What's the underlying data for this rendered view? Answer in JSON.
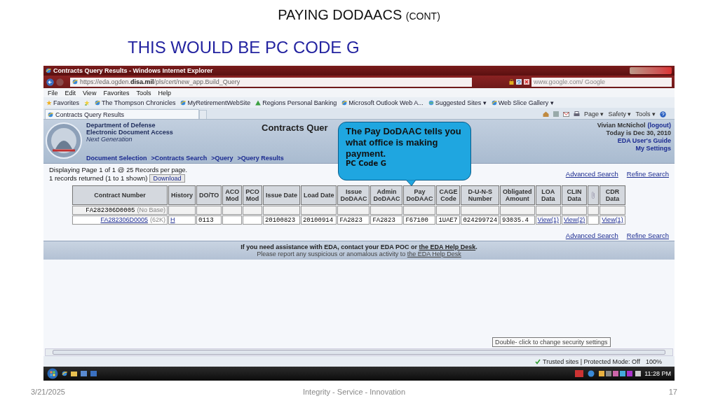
{
  "slide": {
    "title": "PAYING DODAACS",
    "title_suffix": "(CONT)",
    "subtitle": "THIS WOULD BE PC CODE G"
  },
  "browser": {
    "window_title": "Contracts Query Results - Windows Internet Explorer",
    "address": "https://eda.ogden.**disa.mil**/pls/cert/new_app.Build_Query",
    "search_placeholder": "www.google.com/ Google",
    "menu": [
      "File",
      "Edit",
      "View",
      "Favorites",
      "Tools",
      "Help"
    ],
    "favorites_label": "Favorites",
    "favorites": [
      {
        "label": "The Thompson Chronicles",
        "kind": "page"
      },
      {
        "label": "MyRetirementWebSite",
        "kind": "page"
      },
      {
        "label": "Regions  Personal Banking",
        "kind": "warning"
      },
      {
        "label": "Microsoft Outlook Web A...",
        "kind": "page"
      },
      {
        "label": "Suggested Sites ▾",
        "kind": "gallery"
      },
      {
        "label": "Web Slice Gallery ▾",
        "kind": "page"
      }
    ],
    "tab": {
      "label": "Contracts Query Results",
      "selected": true
    },
    "commands": [
      "Page ▾",
      "Safety ▾",
      "Tools ▾"
    ],
    "status": {
      "zone": "Trusted sites | Protected Mode: Off",
      "tooltip": "Double- click to change security settings",
      "zoom": "100%"
    },
    "clock": "11:28 PM"
  },
  "site": {
    "org": [
      "Department of Defense",
      "Electronic Document Access"
    ],
    "org_tagline": "Next Generation",
    "page_title": "Contracts Quer",
    "user": "Vivian McNichol",
    "logout": "(logout)",
    "today": "Today is Dec 30, 2010",
    "guide": "EDA User's Guide",
    "settings": "My Settings",
    "breadcrumb": [
      "Document Selection",
      ">Contracts Search",
      ">Query",
      ">Query Results"
    ],
    "display_line": "Displaying Page 1 of 1 @",
    "per_page": "25 Records per page.",
    "returned": "1 records returned (1 to 1 shown)",
    "download": "Download",
    "links_top": [
      "Advanced Search",
      "Refine Search"
    ],
    "links_bottom": [
      "Advanced Search",
      "Refine Search"
    ],
    "columns": [
      {
        "kind": "text",
        "label": "Contract Number"
      },
      {
        "kind": "text",
        "label": "History"
      },
      {
        "kind": "text",
        "label": "DO/TO"
      },
      {
        "kind": "text",
        "label": "ACO\nMod"
      },
      {
        "kind": "text",
        "label": "PCO\nMod"
      },
      {
        "kind": "text",
        "label": "Issue Date"
      },
      {
        "kind": "text",
        "label": "Load Date"
      },
      {
        "kind": "text",
        "label": "Issue\nDoDAAC"
      },
      {
        "kind": "text",
        "label": "Admin\nDoDAAC"
      },
      {
        "kind": "text",
        "label": "Pay\nDoDAAC"
      },
      {
        "kind": "text",
        "label": "CAGE\nCode"
      },
      {
        "kind": "text",
        "label": "D-U-N-S\nNumber"
      },
      {
        "kind": "text",
        "label": "Obligated\nAmount"
      },
      {
        "kind": "text",
        "label": "LOA\nData"
      },
      {
        "kind": "text",
        "label": "CLIN\nData"
      },
      {
        "kind": "icon"
      },
      {
        "kind": "text",
        "label": "CDR\nData"
      }
    ],
    "rows": [
      {
        "kind": "base",
        "cells": [
          {
            "kind": "text",
            "text": "FA282306D0005",
            "note": "(No Base)"
          },
          {
            "kind": "empty"
          },
          {
            "kind": "empty"
          },
          {
            "kind": "empty"
          },
          {
            "kind": "empty"
          },
          {
            "kind": "empty"
          },
          {
            "kind": "empty"
          },
          {
            "kind": "empty"
          },
          {
            "kind": "empty"
          },
          {
            "kind": "empty"
          },
          {
            "kind": "empty"
          },
          {
            "kind": "empty"
          },
          {
            "kind": "empty"
          },
          {
            "kind": "empty"
          },
          {
            "kind": "empty"
          },
          {
            "kind": "empty"
          },
          {
            "kind": "empty"
          }
        ]
      },
      {
        "kind": "record",
        "cells": [
          {
            "kind": "link",
            "text": "FA282306D0005",
            "note": "(62K)"
          },
          {
            "kind": "link",
            "text": "H"
          },
          {
            "kind": "text",
            "text": "0113"
          },
          {
            "kind": "empty"
          },
          {
            "kind": "empty"
          },
          {
            "kind": "text",
            "text": "20100823"
          },
          {
            "kind": "text",
            "text": "20100914"
          },
          {
            "kind": "text",
            "text": "FA2823"
          },
          {
            "kind": "text",
            "text": "FA2823"
          },
          {
            "kind": "text",
            "text": "F67100"
          },
          {
            "kind": "text",
            "text": "1UAE7"
          },
          {
            "kind": "text",
            "text": "024299724"
          },
          {
            "kind": "text",
            "text": "93035.4"
          },
          {
            "kind": "link",
            "text": "View(1)"
          },
          {
            "kind": "link",
            "text": "View(2)"
          },
          {
            "kind": "empty"
          },
          {
            "kind": "link",
            "text": "View(1)"
          }
        ]
      }
    ],
    "help": [
      {
        "before": "If you need assistance with EDA, contact your EDA POC or ",
        "link": "the EDA Help Desk",
        "after": "."
      },
      {
        "before": "Please report any suspicious or anomalous activity to ",
        "link": "the EDA Help Desk"
      }
    ],
    "callout": {
      "text": "The Pay DoDAAC tells you what office is making payment.",
      "note": "PC Code G"
    }
  },
  "footer": {
    "date": "3/21/2025",
    "center": "Integrity - Service - Innovation",
    "page": "17"
  }
}
